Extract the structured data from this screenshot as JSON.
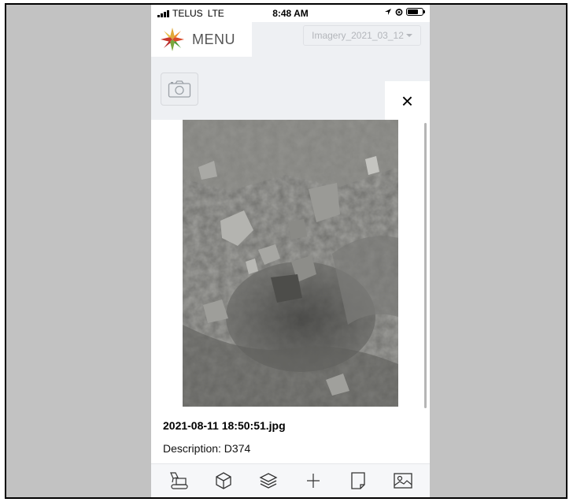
{
  "status_bar": {
    "carrier": "TELUS",
    "network": "LTE",
    "time": "8:48 AM"
  },
  "header": {
    "menu_label": "MENU",
    "imagery_select": "Imagery_2021_03_12"
  },
  "photo_panel": {
    "close_label": "×",
    "filename": "2021-08-11 18:50:51.jpg",
    "description": "Description: D374"
  },
  "toolbar": {
    "items": [
      "excavator-icon",
      "cube-icon",
      "layers-icon",
      "plus-icon",
      "document-icon",
      "image-icon"
    ]
  },
  "colors": {
    "app_background": "#eef0f3",
    "frame_background": "#c2c2c2"
  }
}
